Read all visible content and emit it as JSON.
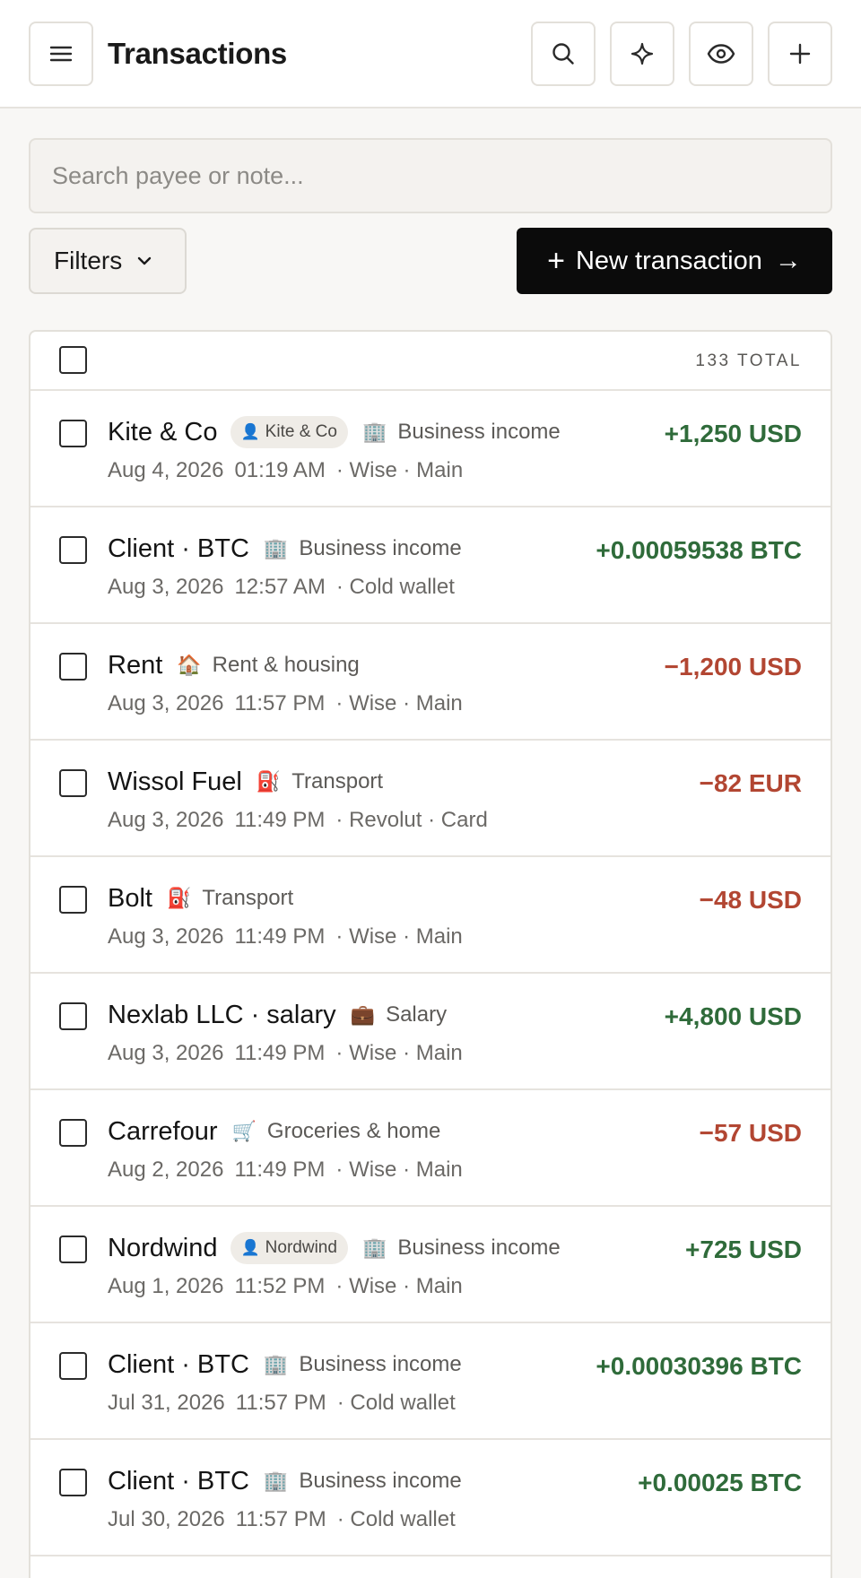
{
  "header": {
    "title": "Transactions",
    "icons": {
      "menu": "menu-icon",
      "search": "search-icon",
      "sparkle": "sparkle-icon",
      "eye": "eye-icon",
      "add": "plus-icon"
    }
  },
  "search": {
    "placeholder": "Search payee or note..."
  },
  "toolbar": {
    "filters_label": "Filters",
    "new_plus": "+",
    "new_label": "New transaction",
    "new_arrow": "→"
  },
  "table": {
    "total_label": "133 TOTAL",
    "rows": [
      {
        "payee": "Kite & Co",
        "chip": {
          "emoji": "👤",
          "label": "Kite & Co"
        },
        "cat_emoji": "🏢",
        "category": "Business income",
        "date": "Aug 4, 2026",
        "time": "01:19 AM",
        "account": "· Wise · Main",
        "amount": "+1,250 USD",
        "sign": "positive"
      },
      {
        "payee": "Client · BTC",
        "chip": null,
        "cat_emoji": "🏢",
        "category": "Business income",
        "date": "Aug 3, 2026",
        "time": "12:57 AM",
        "account": "· Cold wallet",
        "amount": "+0.00059538 BTC",
        "sign": "positive"
      },
      {
        "payee": "Rent",
        "chip": null,
        "cat_emoji": "🏠",
        "category": "Rent & housing",
        "date": "Aug 3, 2026",
        "time": "11:57 PM",
        "account": "· Wise · Main",
        "amount": "−1,200 USD",
        "sign": "negative"
      },
      {
        "payee": "Wissol Fuel",
        "chip": null,
        "cat_emoji": "⛽",
        "category": "Transport",
        "date": "Aug 3, 2026",
        "time": "11:49 PM",
        "account": "· Revolut · Card",
        "amount": "−82 EUR",
        "sign": "negative"
      },
      {
        "payee": "Bolt",
        "chip": null,
        "cat_emoji": "⛽",
        "category": "Transport",
        "date": "Aug 3, 2026",
        "time": "11:49 PM",
        "account": "· Wise · Main",
        "amount": "−48 USD",
        "sign": "negative"
      },
      {
        "payee": "Nexlab LLC · salary",
        "chip": null,
        "cat_emoji": "💼",
        "category": "Salary",
        "date": "Aug 3, 2026",
        "time": "11:49 PM",
        "account": "· Wise · Main",
        "amount": "+4,800 USD",
        "sign": "positive"
      },
      {
        "payee": "Carrefour",
        "chip": null,
        "cat_emoji": "🛒",
        "category": "Groceries & home",
        "date": "Aug 2, 2026",
        "time": "11:49 PM",
        "account": "· Wise · Main",
        "amount": "−57 USD",
        "sign": "negative"
      },
      {
        "payee": "Nordwind",
        "chip": {
          "emoji": "👤",
          "label": "Nordwind"
        },
        "cat_emoji": "🏢",
        "category": "Business income",
        "date": "Aug 1, 2026",
        "time": "11:52 PM",
        "account": "· Wise · Main",
        "amount": "+725 USD",
        "sign": "positive"
      },
      {
        "payee": "Client · BTC",
        "chip": null,
        "cat_emoji": "🏢",
        "category": "Business income",
        "date": "Jul 31, 2026",
        "time": "11:57 PM",
        "account": "· Cold wallet",
        "amount": "+0.00030396 BTC",
        "sign": "positive"
      },
      {
        "payee": "Client · BTC",
        "chip": null,
        "cat_emoji": "🏢",
        "category": "Business income",
        "date": "Jul 30, 2026",
        "time": "11:57 PM",
        "account": "· Cold wallet",
        "amount": "+0.00025 BTC",
        "sign": "positive"
      }
    ]
  },
  "colors": {
    "positive": "#2f6b3a",
    "negative": "#b24632",
    "primary_button": "#0b0b0b",
    "background": "#f8f7f5"
  }
}
